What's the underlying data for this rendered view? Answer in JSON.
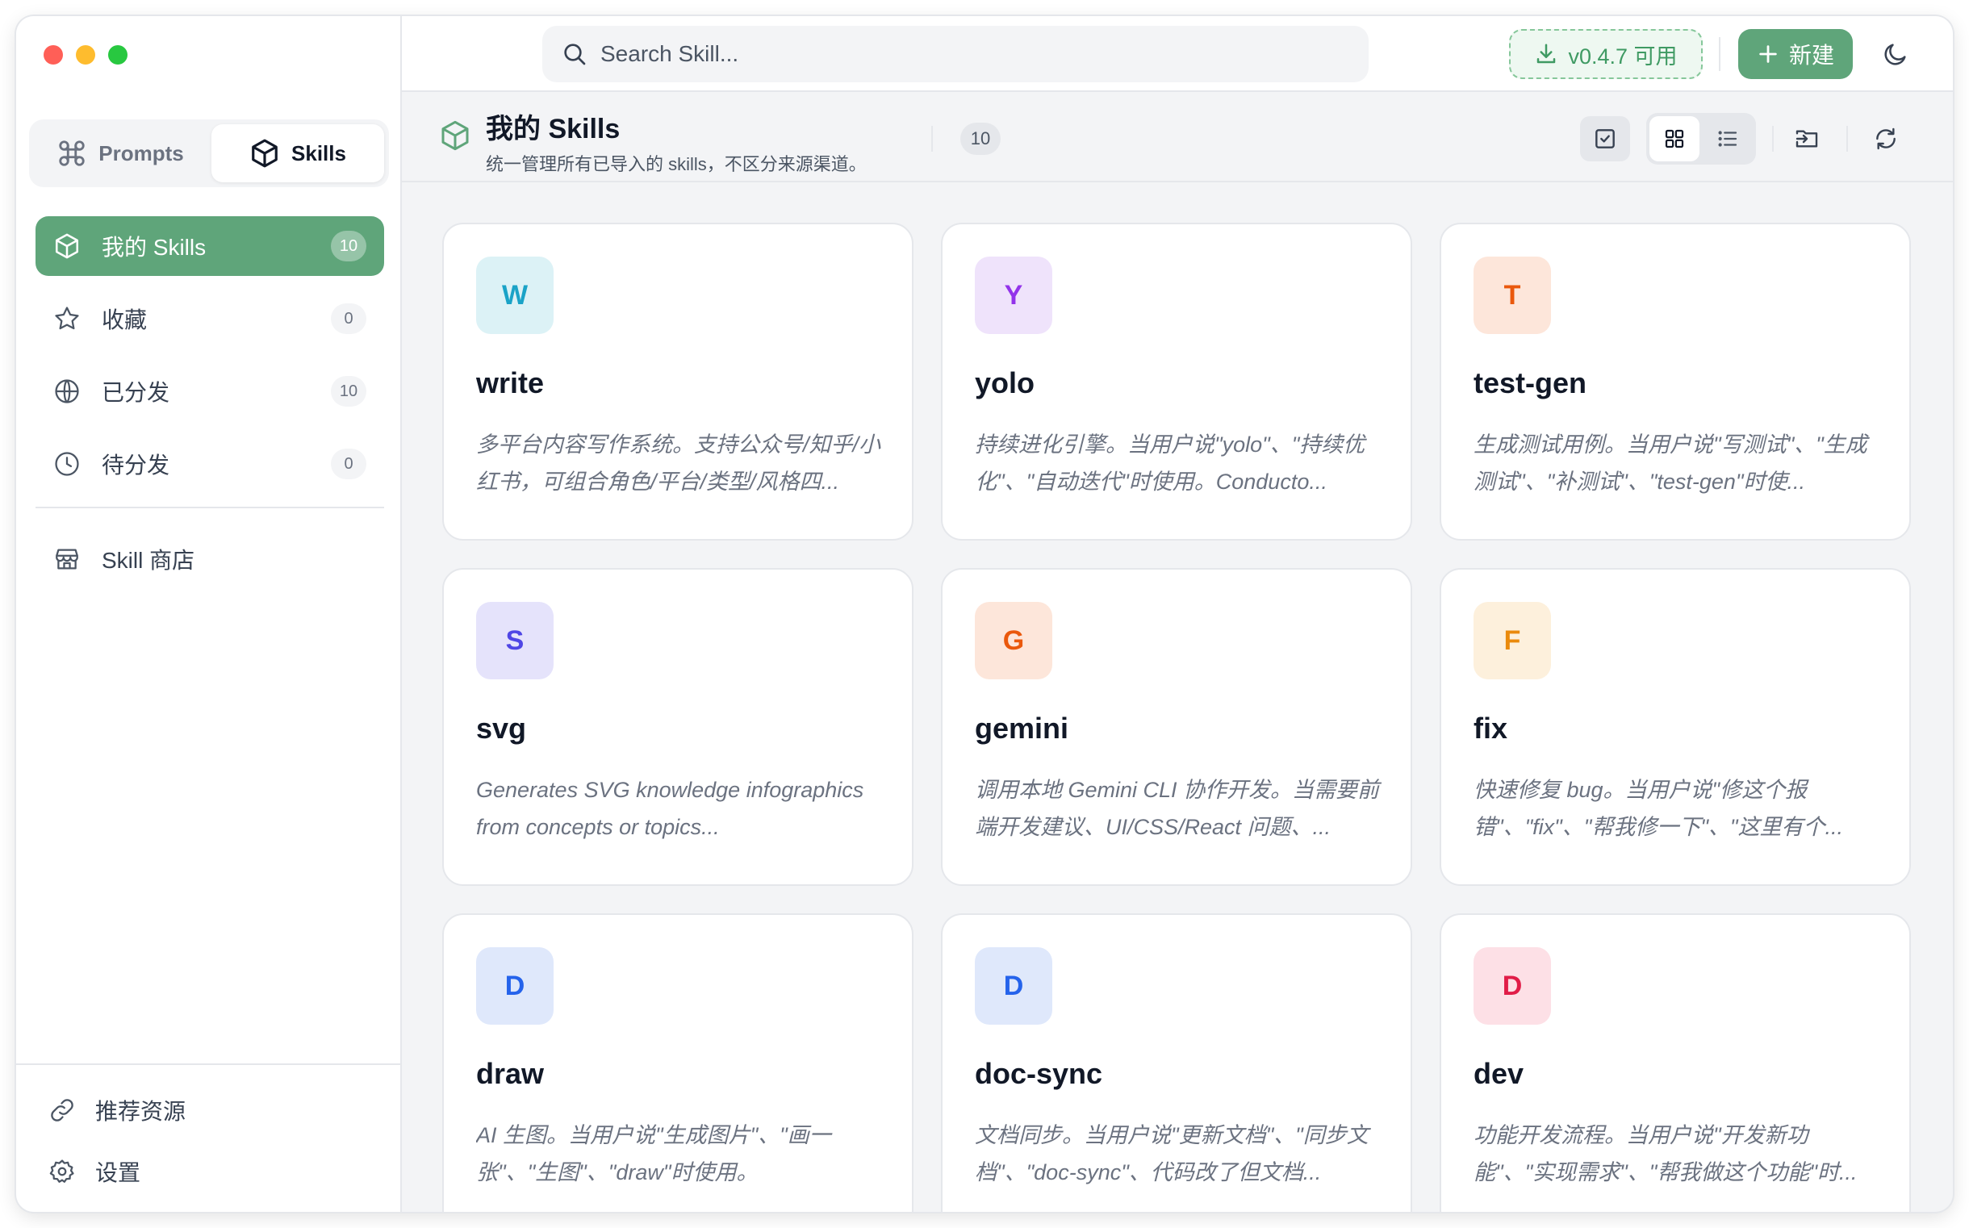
{
  "sidebar": {
    "modes": [
      {
        "label": "Prompts",
        "icon": "command-icon",
        "active": false
      },
      {
        "label": "Skills",
        "icon": "cube-icon",
        "active": true
      }
    ],
    "nav": [
      {
        "label": "我的 Skills",
        "count": "10",
        "icon": "cube-icon",
        "active": true
      },
      {
        "label": "收藏",
        "count": "0",
        "icon": "star-icon",
        "active": false
      },
      {
        "label": "已分发",
        "count": "10",
        "icon": "globe-icon",
        "active": false
      },
      {
        "label": "待分发",
        "count": "0",
        "icon": "clock-icon",
        "active": false
      }
    ],
    "store": {
      "label": "Skill 商店",
      "icon": "store-icon"
    },
    "bottom": [
      {
        "label": "推荐资源",
        "icon": "link-icon"
      },
      {
        "label": "设置",
        "icon": "gear-icon"
      }
    ]
  },
  "topbar": {
    "search_placeholder": "Search Skill...",
    "update_label": "v0.4.7 可用",
    "new_label": "新建"
  },
  "header": {
    "title": "我的 Skills",
    "subtitle": "统一管理所有已导入的 skills，不区分来源渠道。",
    "count": "10"
  },
  "colors": {
    "accent": "#5fa57a",
    "background": "#f3f4f6"
  },
  "skills": [
    {
      "letter": "W",
      "name": "write",
      "desc": "多平台内容写作系统。支持公众号/知乎/小红书，可组合角色/平台/类型/风格四...",
      "bg": "#dcf2f6",
      "fg": "#1aa3c7"
    },
    {
      "letter": "Y",
      "name": "yolo",
      "desc": "持续进化引擎。当用户说\"yolo\"、\"持续优化\"、\"自动迭代\"时使用。Conducto...",
      "bg": "#efe3fb",
      "fg": "#9333ea"
    },
    {
      "letter": "T",
      "name": "test-gen",
      "desc": "生成测试用例。当用户说\"写测试\"、\"生成测试\"、\"补测试\"、\"test-gen\"时使...",
      "bg": "#fde6da",
      "fg": "#ea580c"
    },
    {
      "letter": "S",
      "name": "svg",
      "desc": "Generates SVG knowledge infographics from concepts or topics...",
      "bg": "#e5e3fb",
      "fg": "#4f46e5"
    },
    {
      "letter": "G",
      "name": "gemini",
      "desc": "调用本地 Gemini CLI 协作开发。当需要前端开发建议、UI/CSS/React 问题、...",
      "bg": "#fde6da",
      "fg": "#ea580c"
    },
    {
      "letter": "F",
      "name": "fix",
      "desc": "快速修复 bug。当用户说\"修这个报错\"、\"fix\"、\"帮我修一下\"、\"这里有个...",
      "bg": "#fdf0dc",
      "fg": "#ea8a0c"
    },
    {
      "letter": "D",
      "name": "draw",
      "desc": "AI 生图。当用户说\"生成图片\"、\"画一张\"、\"生图\"、\"draw\"时使用。",
      "bg": "#dfe8fb",
      "fg": "#2563eb"
    },
    {
      "letter": "D",
      "name": "doc-sync",
      "desc": "文档同步。当用户说\"更新文档\"、\"同步文档\"、\"doc-sync\"、代码改了但文档...",
      "bg": "#dfe8fb",
      "fg": "#2563eb"
    },
    {
      "letter": "D",
      "name": "dev",
      "desc": "功能开发流程。当用户说\"开发新功能\"、\"实现需求\"、\"帮我做这个功能\"时...",
      "bg": "#fde0e6",
      "fg": "#e11d48"
    }
  ]
}
